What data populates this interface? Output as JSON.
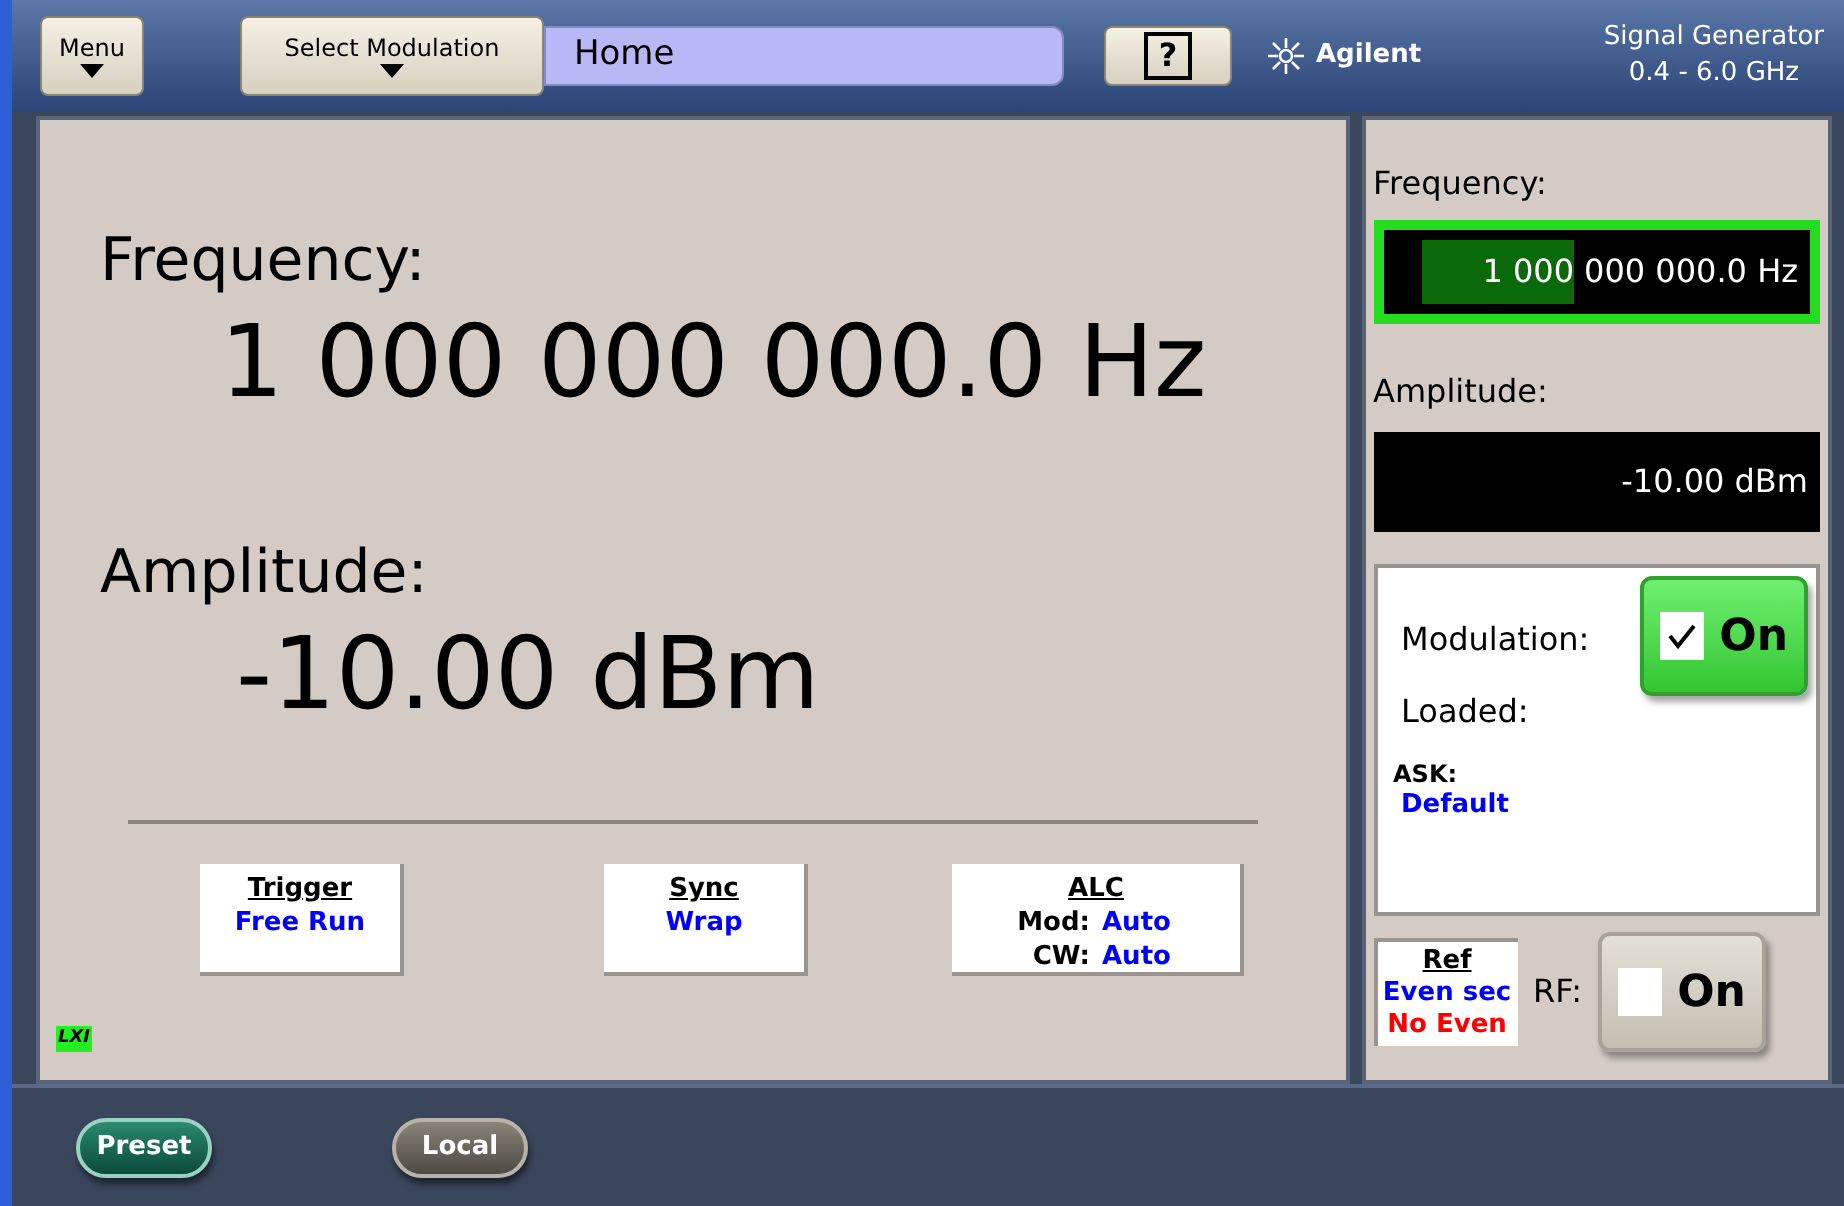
{
  "top_bar": {
    "menu_button": "Menu",
    "modulation_button": "Select Modulation",
    "screen_title": "Home",
    "help_button": "?",
    "brand": "Agilent",
    "instrument": "Signal Generator",
    "range": "0.4 - 6.0 GHz"
  },
  "main": {
    "frequency_label": "Frequency:",
    "frequency_value": "1 000 000 000.0 Hz",
    "amplitude_label": "Amplitude:",
    "amplitude_value": "-10.00 dBm",
    "lxi_badge": "LXI",
    "status_boxes": [
      {
        "title": "Trigger",
        "lines": [
          {
            "value": "Free Run"
          }
        ]
      },
      {
        "title": "Sync",
        "lines": [
          {
            "value": "Wrap"
          }
        ]
      },
      {
        "title": "ALC",
        "lines": [
          {
            "label": "Mod:",
            "value": "Auto"
          },
          {
            "label": "CW:",
            "value": "Auto"
          }
        ]
      }
    ]
  },
  "side": {
    "frequency_label": "Frequency:",
    "frequency_selected": "1 000",
    "frequency_rest": "000 000.0 Hz",
    "frequency_active": true,
    "amplitude_label": "Amplitude:",
    "amplitude_value": "-10.00 dBm",
    "amplitude_active": false,
    "modulation_label": "Modulation:",
    "modulation_toggle": {
      "label": "On",
      "checked": true
    },
    "loaded_label": "Loaded:",
    "format_label": "ASK:",
    "format_value": "Default",
    "ref": {
      "title": "Ref",
      "lines": [
        {
          "text": "Even sec",
          "color": "#0000ff"
        },
        {
          "text": "No Even",
          "color": "#ff0000"
        }
      ]
    },
    "rf_label": "RF:",
    "rf_toggle": {
      "label": "On",
      "checked": false
    }
  },
  "bottom_bar": {
    "buttons": [
      {
        "label": "Preset",
        "kind": "green"
      },
      {
        "label": "Local",
        "kind": "gray"
      }
    ]
  }
}
